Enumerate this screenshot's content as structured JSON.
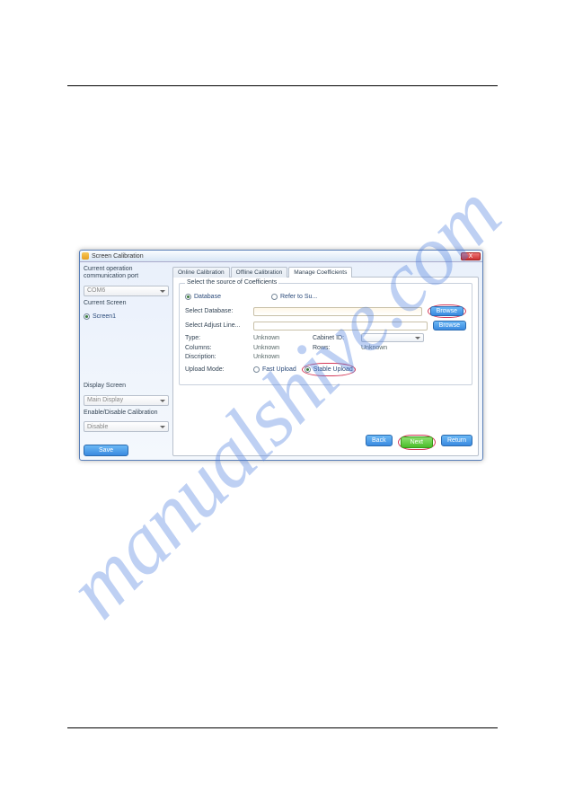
{
  "watermark": "manualshive.com",
  "window": {
    "title": "Screen Calibration",
    "close": "X"
  },
  "left": {
    "comm_port_label": "Current operation communication port",
    "com_value": "COM6",
    "current_screen_label": "Current Screen",
    "screen1": "Screen1",
    "display_screen_label": "Display Screen",
    "display_value": "Main Display",
    "enable_disable_label": "Enable/Disable Calibration",
    "enable_value": "Disable",
    "save_btn": "Save"
  },
  "tabs": {
    "online": "Online Calibration",
    "offline": "Offline Calibration",
    "manage": "Manage Coefficients"
  },
  "group": {
    "legend": "Select the source of Coefficients",
    "radio_database": "Database",
    "radio_refer": "Refer to Su...",
    "select_database": "Select Database:",
    "select_adjust": "Select Adjust Line...",
    "type_label": "Type:",
    "type_value": "Unknown",
    "cabinet_id_label": "Cabinet ID:",
    "columns_label": "Columns:",
    "columns_value": "Unknown",
    "rows_label": "Rows:",
    "rows_value": "Unknown",
    "description_label": "Discription:",
    "description_value": "Unknown",
    "upload_mode_label": "Upload Mode:",
    "fast_upload": "Fast Upload",
    "stable_upload": "Stable Upload",
    "browse": "Browse"
  },
  "footer": {
    "back": "Back",
    "next": "Next",
    "return": "Return"
  }
}
